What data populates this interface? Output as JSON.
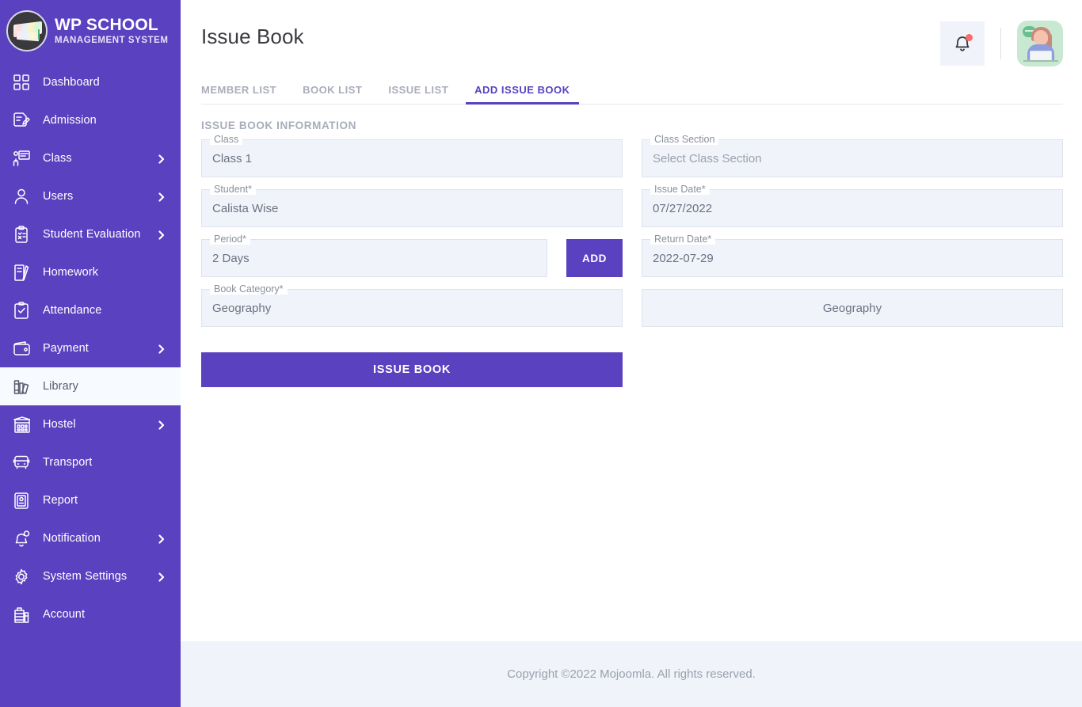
{
  "brand": {
    "title": "WP SCHOOL",
    "subtitle": "MANAGEMENT SYSTEM",
    "logo_icon": "graduation-cap-logo"
  },
  "sidebar": {
    "accent_color": "#5941c0",
    "active_item_bg": "#f7fbff",
    "items": [
      {
        "label": "Dashboard",
        "icon": "grid-icon",
        "expandable": false,
        "active": false
      },
      {
        "label": "Admission",
        "icon": "document-edit-icon",
        "expandable": false,
        "active": false
      },
      {
        "label": "Class",
        "icon": "classroom-icon",
        "expandable": true,
        "active": false
      },
      {
        "label": "Users",
        "icon": "user-icon",
        "expandable": true,
        "active": false
      },
      {
        "label": "Student Evaluation",
        "icon": "clipboard-check-icon",
        "expandable": true,
        "active": false
      },
      {
        "label": "Homework",
        "icon": "book-pen-icon",
        "expandable": false,
        "active": false
      },
      {
        "label": "Attendance",
        "icon": "checklist-icon",
        "expandable": false,
        "active": false
      },
      {
        "label": "Payment",
        "icon": "wallet-icon",
        "expandable": true,
        "active": false
      },
      {
        "label": "Library",
        "icon": "books-icon",
        "expandable": false,
        "active": true
      },
      {
        "label": "Hostel",
        "icon": "building-icon",
        "expandable": true,
        "active": false
      },
      {
        "label": "Transport",
        "icon": "bus-icon",
        "expandable": false,
        "active": false
      },
      {
        "label": "Report",
        "icon": "report-icon",
        "expandable": false,
        "active": false
      },
      {
        "label": "Notification",
        "icon": "bell-pin-icon",
        "expandable": true,
        "active": false
      },
      {
        "label": "System Settings",
        "icon": "gear-icon",
        "expandable": true,
        "active": false
      },
      {
        "label": "Account",
        "icon": "bank-icon",
        "expandable": false,
        "active": false
      }
    ]
  },
  "header": {
    "title": "Issue Book",
    "notification_icon": "bell-icon",
    "notification_has_badge": true,
    "notification_badge_color": "#fc6a6a",
    "avatar_icon": "support-agent-avatar"
  },
  "tabs": [
    {
      "label": "MEMBER LIST",
      "active": false
    },
    {
      "label": "BOOK LIST",
      "active": false
    },
    {
      "label": "ISSUE LIST",
      "active": false
    },
    {
      "label": "ADD ISSUE BOOK",
      "active": true
    }
  ],
  "form": {
    "section_title": "ISSUE BOOK INFORMATION",
    "class": {
      "label": "Class",
      "value": "Class 1",
      "empty": false
    },
    "class_section": {
      "label": "Class Section",
      "value": "Select Class Section",
      "empty": true
    },
    "student": {
      "label": "Student*",
      "value": "Calista Wise",
      "empty": false
    },
    "issue_date": {
      "label": "Issue Date*",
      "value": "07/27/2022",
      "empty": false
    },
    "period": {
      "label": "Period*",
      "value": "2 Days",
      "empty": false
    },
    "return_date": {
      "label": "Return Date*",
      "value": "2022-07-29",
      "empty": false
    },
    "book_category": {
      "label": "Book Category*",
      "value": "Geography",
      "empty": false
    },
    "selected_book": {
      "value": "Geography"
    },
    "add_button_label": "ADD",
    "submit_button_label": "ISSUE BOOK",
    "button_color": "#5941c0"
  },
  "footer": {
    "text": "Copyright ©2022 Mojoomla. All rights reserved."
  }
}
